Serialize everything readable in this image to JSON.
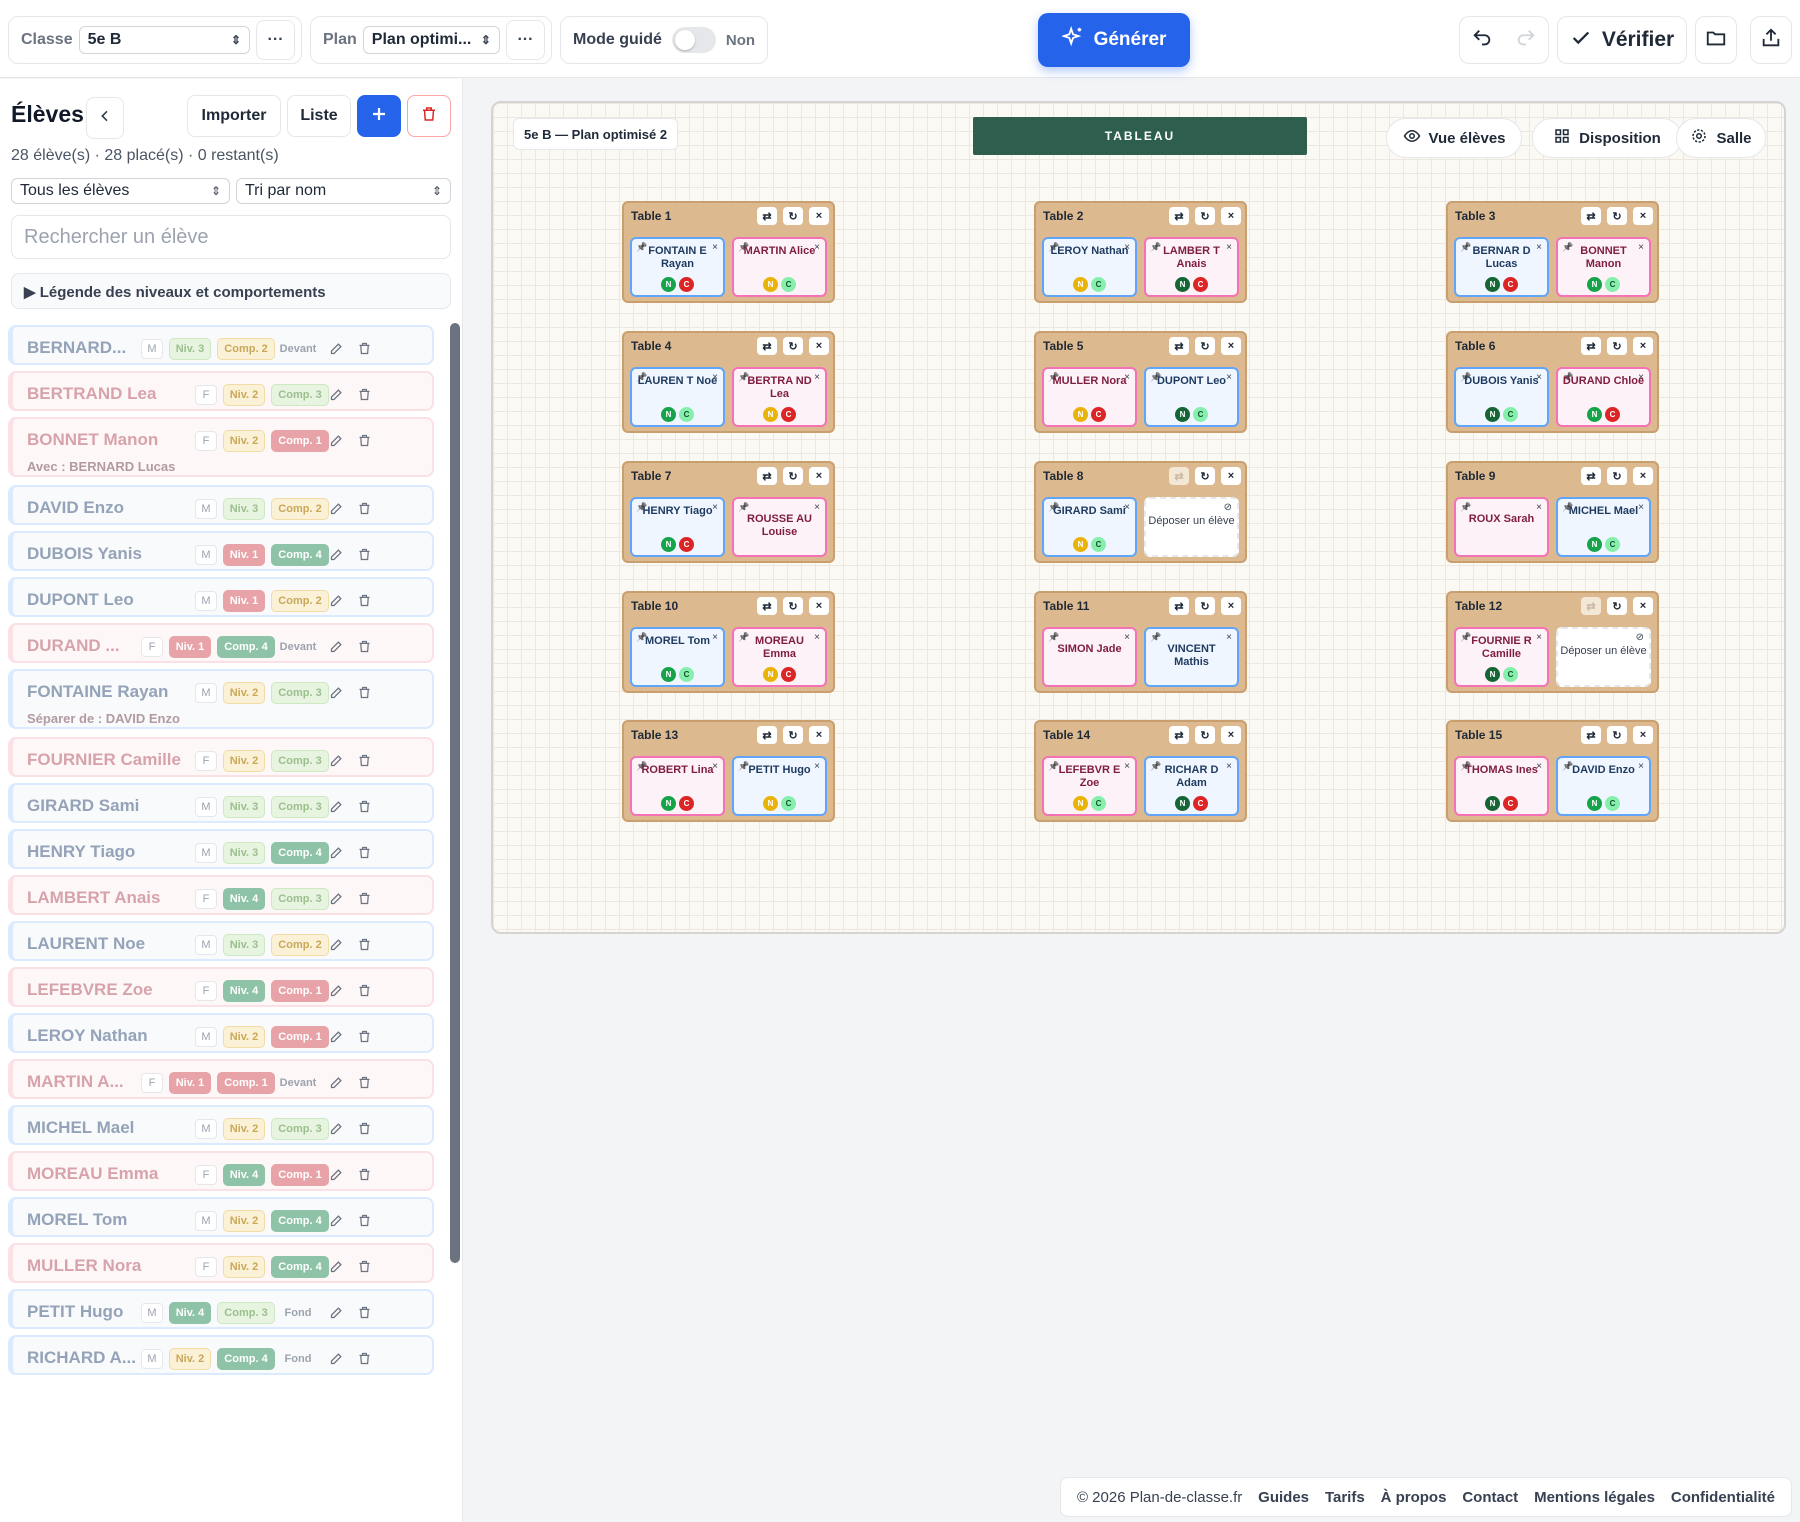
{
  "toolbar": {
    "classe_label": "Classe",
    "classe_value": "5e B",
    "plan_label": "Plan",
    "plan_value": "Plan optimi...",
    "mode_label": "Mode guidé",
    "mode_value": "Non",
    "generate_label": "Générer",
    "verify_label": "Vérifier",
    "more_glyph": "···"
  },
  "sidebar": {
    "title": "Élèves",
    "import_label": "Importer",
    "list_label": "Liste",
    "counts": "28 élève(s) · 28 placé(s) · 0 restant(s)",
    "filter_value": "Tous les élèves",
    "sort_value": "Tri par nom",
    "search_placeholder": "Rechercher un élève",
    "legend": "▶ Légende des niveaux et comportements",
    "students": [
      {
        "name": "BERNARD...",
        "sex": "M",
        "niv": "Niv. 3",
        "comp": "Comp. 2",
        "extra": "Devant",
        "sub": ""
      },
      {
        "name": "BERTRAND Lea",
        "sex": "F",
        "niv": "Niv. 2",
        "comp": "Comp. 3",
        "extra": "",
        "sub": ""
      },
      {
        "name": "BONNET Manon",
        "sex": "F",
        "niv": "Niv. 2",
        "comp": "Comp. 1",
        "extra": "",
        "sub": "Avec : BERNARD Lucas"
      },
      {
        "name": "DAVID Enzo",
        "sex": "M",
        "niv": "Niv. 3",
        "comp": "Comp. 2",
        "extra": "",
        "sub": ""
      },
      {
        "name": "DUBOIS Yanis",
        "sex": "M",
        "niv": "Niv. 1",
        "comp": "Comp. 4",
        "extra": "",
        "sub": ""
      },
      {
        "name": "DUPONT Leo",
        "sex": "M",
        "niv": "Niv. 1",
        "comp": "Comp. 2",
        "extra": "",
        "sub": ""
      },
      {
        "name": "DURAND ...",
        "sex": "F",
        "niv": "Niv. 1",
        "comp": "Comp. 4",
        "extra": "Devant",
        "sub": ""
      },
      {
        "name": "FONTAINE Rayan",
        "sex": "M",
        "niv": "Niv. 2",
        "comp": "Comp. 3",
        "extra": "",
        "sub": "Séparer de : DAVID Enzo"
      },
      {
        "name": "FOURNIER Camille",
        "sex": "F",
        "niv": "Niv. 2",
        "comp": "Comp. 3",
        "extra": "",
        "sub": ""
      },
      {
        "name": "GIRARD Sami",
        "sex": "M",
        "niv": "Niv. 3",
        "comp": "Comp. 3",
        "extra": "",
        "sub": ""
      },
      {
        "name": "HENRY Tiago",
        "sex": "M",
        "niv": "Niv. 3",
        "comp": "Comp. 4",
        "extra": "",
        "sub": ""
      },
      {
        "name": "LAMBERT Anais",
        "sex": "F",
        "niv": "Niv. 4",
        "comp": "Comp. 3",
        "extra": "",
        "sub": ""
      },
      {
        "name": "LAURENT Noe",
        "sex": "M",
        "niv": "Niv. 3",
        "comp": "Comp. 2",
        "extra": "",
        "sub": ""
      },
      {
        "name": "LEFEBVRE Zoe",
        "sex": "F",
        "niv": "Niv. 4",
        "comp": "Comp. 1",
        "extra": "",
        "sub": ""
      },
      {
        "name": "LEROY Nathan",
        "sex": "M",
        "niv": "Niv. 2",
        "comp": "Comp. 1",
        "extra": "",
        "sub": ""
      },
      {
        "name": "MARTIN A...",
        "sex": "F",
        "niv": "Niv. 1",
        "comp": "Comp. 1",
        "extra": "Devant",
        "sub": ""
      },
      {
        "name": "MICHEL Mael",
        "sex": "M",
        "niv": "Niv. 2",
        "comp": "Comp. 3",
        "extra": "",
        "sub": ""
      },
      {
        "name": "MOREAU Emma",
        "sex": "F",
        "niv": "Niv. 4",
        "comp": "Comp. 1",
        "extra": "",
        "sub": ""
      },
      {
        "name": "MOREL Tom",
        "sex": "M",
        "niv": "Niv. 2",
        "comp": "Comp. 4",
        "extra": "",
        "sub": ""
      },
      {
        "name": "MULLER Nora",
        "sex": "F",
        "niv": "Niv. 2",
        "comp": "Comp. 4",
        "extra": "",
        "sub": ""
      },
      {
        "name": "PETIT Hugo",
        "sex": "M",
        "niv": "Niv. 4",
        "comp": "Comp. 3",
        "extra": "Fond",
        "sub": ""
      },
      {
        "name": "RICHARD A...",
        "sex": "M",
        "niv": "Niv. 2",
        "comp": "Comp. 4",
        "extra": "Fond",
        "sub": ""
      }
    ]
  },
  "plan": {
    "title": "5e B — Plan optimisé 2",
    "board": "TABLEAU",
    "view_label": "Vue élèves",
    "layout_label": "Disposition",
    "room_label": "Salle",
    "empty_label": "Déposer un élève",
    "tables": [
      {
        "label": "Table 1",
        "seats": [
          {
            "name": "FONTAIN E Rayan",
            "sex": "M",
            "a": "N",
            "b": "C"
          },
          {
            "name": "MARTIN Alice",
            "sex": "F",
            "a": "N",
            "b": "C"
          }
        ]
      },
      {
        "label": "Table 2",
        "seats": [
          {
            "name": "LEROY Nathan",
            "sex": "M",
            "a": "N",
            "b": "C"
          },
          {
            "name": "LAMBER T Anais",
            "sex": "F",
            "a": "N",
            "b": "C"
          }
        ]
      },
      {
        "label": "Table 3",
        "seats": [
          {
            "name": "BERNAR D Lucas",
            "sex": "M",
            "a": "N",
            "b": "C"
          },
          {
            "name": "BONNET Manon",
            "sex": "F",
            "a": "N",
            "b": "C"
          }
        ]
      },
      {
        "label": "Table 4",
        "seats": [
          {
            "name": "LAUREN T Noe",
            "sex": "M",
            "a": "N",
            "b": "C"
          },
          {
            "name": "BERTRA ND Lea",
            "sex": "F",
            "a": "N",
            "b": "C"
          }
        ]
      },
      {
        "label": "Table 5",
        "seats": [
          {
            "name": "MULLER Nora",
            "sex": "F",
            "a": "N",
            "b": "C"
          },
          {
            "name": "DUPONT Leo",
            "sex": "M",
            "a": "N",
            "b": "C"
          }
        ]
      },
      {
        "label": "Table 6",
        "seats": [
          {
            "name": "DUBOIS Yanis",
            "sex": "M",
            "a": "N",
            "b": "C"
          },
          {
            "name": "DURAND Chloe",
            "sex": "F",
            "a": "N",
            "b": "C"
          }
        ]
      },
      {
        "label": "Table 7",
        "seats": [
          {
            "name": "HENRY Tiago",
            "sex": "M",
            "a": "N",
            "b": "C"
          },
          {
            "name": "ROUSSE AU Louise",
            "sex": "F",
            "a": "",
            "b": ""
          }
        ]
      },
      {
        "label": "Table 8",
        "seats": [
          {
            "name": "GIRARD Sami",
            "sex": "M",
            "a": "N",
            "b": "C"
          },
          {
            "name": "",
            "sex": "",
            "a": "",
            "b": ""
          }
        ]
      },
      {
        "label": "Table 9",
        "seats": [
          {
            "name": "ROUX Sarah",
            "sex": "F",
            "a": "",
            "b": ""
          },
          {
            "name": "MICHEL Mael",
            "sex": "M",
            "a": "N",
            "b": "C"
          }
        ]
      },
      {
        "label": "Table 10",
        "seats": [
          {
            "name": "MOREL Tom",
            "sex": "M",
            "a": "N",
            "b": "C"
          },
          {
            "name": "MOREAU Emma",
            "sex": "F",
            "a": "N",
            "b": "C"
          }
        ]
      },
      {
        "label": "Table 11",
        "seats": [
          {
            "name": "SIMON Jade",
            "sex": "F",
            "a": "",
            "b": ""
          },
          {
            "name": "VINCENT Mathis",
            "sex": "M",
            "a": "",
            "b": ""
          }
        ]
      },
      {
        "label": "Table 12",
        "seats": [
          {
            "name": "FOURNIE R Camille",
            "sex": "F",
            "a": "N",
            "b": "C"
          },
          {
            "name": "",
            "sex": "",
            "a": "",
            "b": ""
          }
        ]
      },
      {
        "label": "Table 13",
        "seats": [
          {
            "name": "ROBERT Lina",
            "sex": "F",
            "a": "N",
            "b": "C"
          },
          {
            "name": "PETIT Hugo",
            "sex": "M",
            "a": "N",
            "b": "C"
          }
        ]
      },
      {
        "label": "Table 14",
        "seats": [
          {
            "name": "LEFEBVR E Zoe",
            "sex": "F",
            "a": "N",
            "b": "C"
          },
          {
            "name": "RICHAR D Adam",
            "sex": "M",
            "a": "N",
            "b": "C"
          }
        ]
      },
      {
        "label": "Table 15",
        "seats": [
          {
            "name": "THOMAS Ines",
            "sex": "F",
            "a": "N",
            "b": "C"
          },
          {
            "name": "DAVID Enzo",
            "sex": "M",
            "a": "N",
            "b": "C"
          }
        ]
      }
    ]
  },
  "footer": {
    "copyright": "© 2026 Plan-de-classe.fr",
    "links": [
      "Guides",
      "Tarifs",
      "À propos",
      "Contact",
      "Mentions légales",
      "Confidentialité"
    ]
  },
  "colors": {
    "accent": "#2563eb",
    "board": "#2e5e4e",
    "table": "#dcb98f",
    "boy": "#60a5fa",
    "girl": "#f472b6",
    "danger": "#dc2626"
  }
}
